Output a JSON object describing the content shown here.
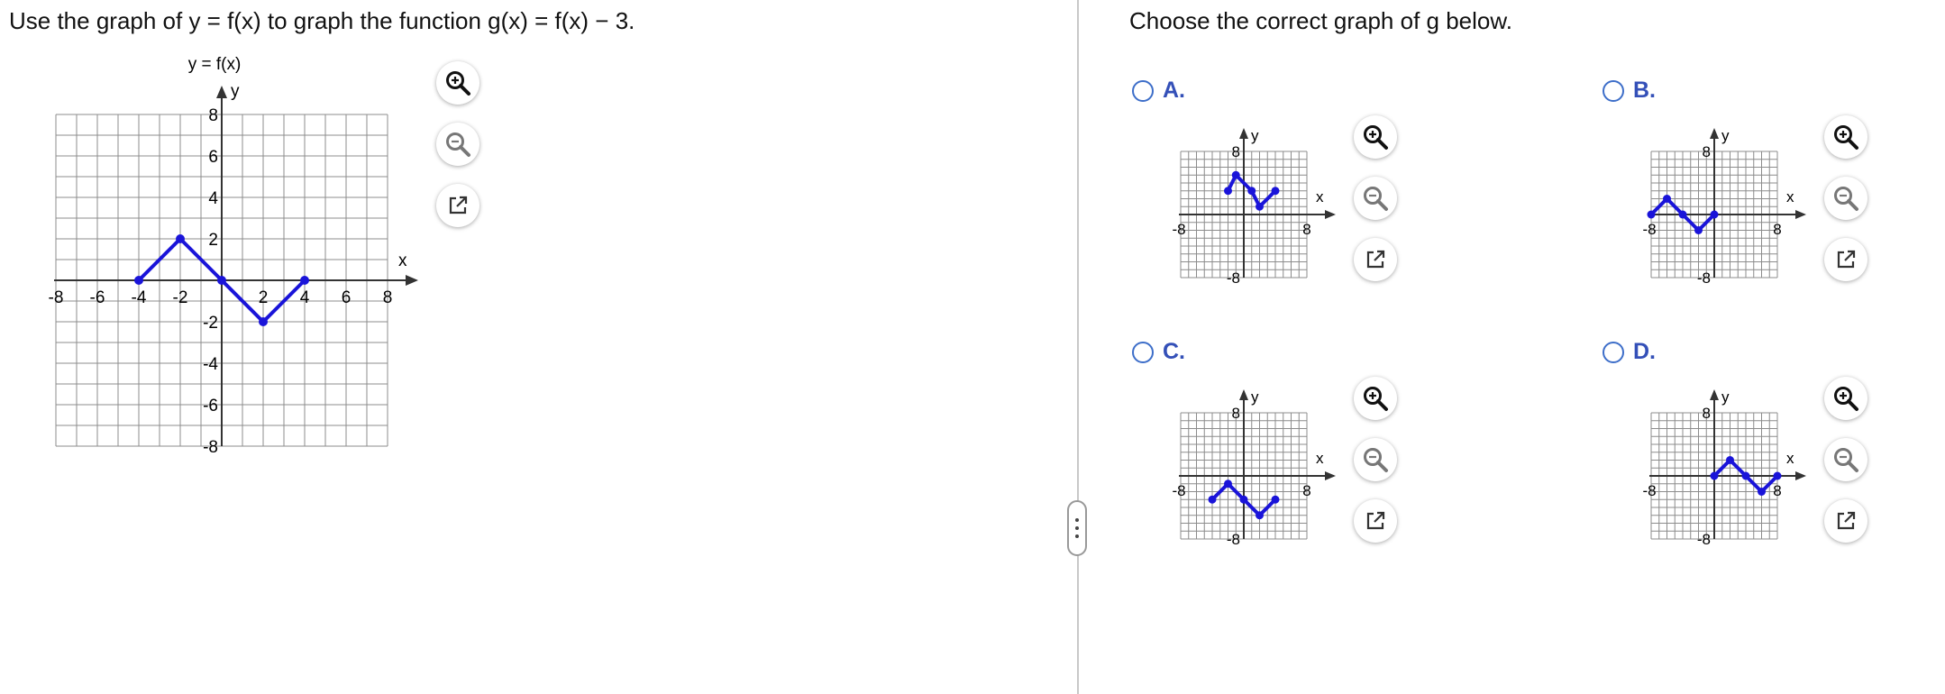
{
  "question": "Use the graph of y = f(x) to graph the function g(x) = f(x) − 3.",
  "prompt": "Choose the correct graph of g below.",
  "main_graph": {
    "title": "y = f(x)",
    "x_label": "x",
    "y_label": "y",
    "x_ticks": [
      "-8",
      "-6",
      "-4",
      "-2",
      "2",
      "4",
      "6",
      "8"
    ],
    "y_ticks": [
      "8",
      "6",
      "4",
      "2",
      "-2",
      "-4",
      "-6",
      "-8"
    ],
    "range": [
      -8,
      8
    ],
    "points": [
      [
        -4,
        0
      ],
      [
        -2,
        2
      ],
      [
        0,
        0
      ],
      [
        2,
        -2
      ],
      [
        4,
        0
      ]
    ]
  },
  "options": [
    {
      "letter": "A.",
      "x_label": "x",
      "y_label": "y",
      "tick_neg": "-8",
      "tick_pos": "8",
      "points": [
        [
          -2,
          3
        ],
        [
          -1,
          5
        ],
        [
          1,
          3
        ],
        [
          2,
          1
        ],
        [
          4,
          3
        ]
      ]
    },
    {
      "letter": "B.",
      "x_label": "x",
      "y_label": "y",
      "tick_neg": "-8",
      "tick_pos": "8",
      "points": [
        [
          -8,
          0
        ],
        [
          -6,
          2
        ],
        [
          -4,
          0
        ],
        [
          -2,
          -2
        ],
        [
          0,
          0
        ]
      ]
    },
    {
      "letter": "C.",
      "x_label": "x",
      "y_label": "y",
      "tick_neg": "-8",
      "tick_pos": "8",
      "points": [
        [
          -4,
          -3
        ],
        [
          -2,
          -1
        ],
        [
          0,
          -3
        ],
        [
          2,
          -5
        ],
        [
          4,
          -3
        ]
      ]
    },
    {
      "letter": "D.",
      "x_label": "x",
      "y_label": "y",
      "tick_neg": "-8",
      "tick_pos": "8",
      "points": [
        [
          0,
          0
        ],
        [
          2,
          2
        ],
        [
          4,
          0
        ],
        [
          6,
          -2
        ],
        [
          8,
          0
        ]
      ]
    }
  ],
  "colors": {
    "curve": "#1a14d9",
    "grid": "#8c8c8c",
    "axis": "#333333",
    "option_text": "#3450b8",
    "radio": "#3d6ec9"
  },
  "tools": [
    "zoom-in-icon",
    "zoom-out-icon",
    "new-window-icon"
  ]
}
